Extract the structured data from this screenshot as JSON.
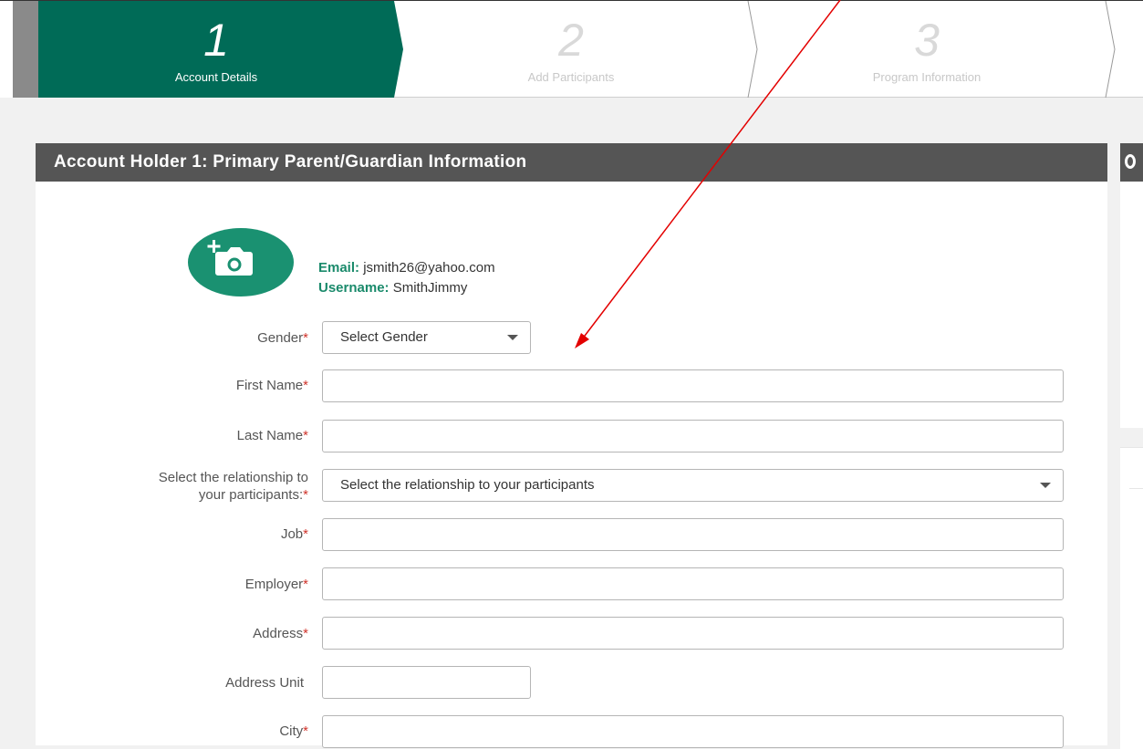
{
  "stepper": {
    "steps": [
      {
        "number": "1",
        "label": "Account Details",
        "active": true
      },
      {
        "number": "2",
        "label": "Add Participants",
        "active": false
      },
      {
        "number": "3",
        "label": "Program Information",
        "active": false
      }
    ],
    "colors": {
      "active": "#006b57",
      "divider": "#8a8a8a"
    }
  },
  "card": {
    "title": "Account Holder 1: Primary Parent/Guardian Information"
  },
  "account": {
    "avatar_icon": "add-photo-camera-icon",
    "email_label": "Email:",
    "email_value": "jsmith26@yahoo.com",
    "username_label": "Username:",
    "username_value": "SmithJimmy"
  },
  "form": {
    "gender_label": "Gender",
    "gender_value": "Select Gender",
    "first_name_label": "First Name",
    "last_name_label": "Last Name",
    "relationship_label_line1": "Select the relationship to",
    "relationship_label_line2": "your participants:",
    "relationship_value": "Select the relationship to your participants",
    "job_label": "Job",
    "employer_label": "Employer",
    "address_label": "Address",
    "address_unit_label": "Address Unit",
    "city_label": "City",
    "required_marker": "*"
  },
  "annotation": {
    "color": "#e30000",
    "type": "arrow"
  },
  "colors": {
    "accent": "#1a9171",
    "header_bg": "#555555",
    "required": "#d0342c"
  }
}
